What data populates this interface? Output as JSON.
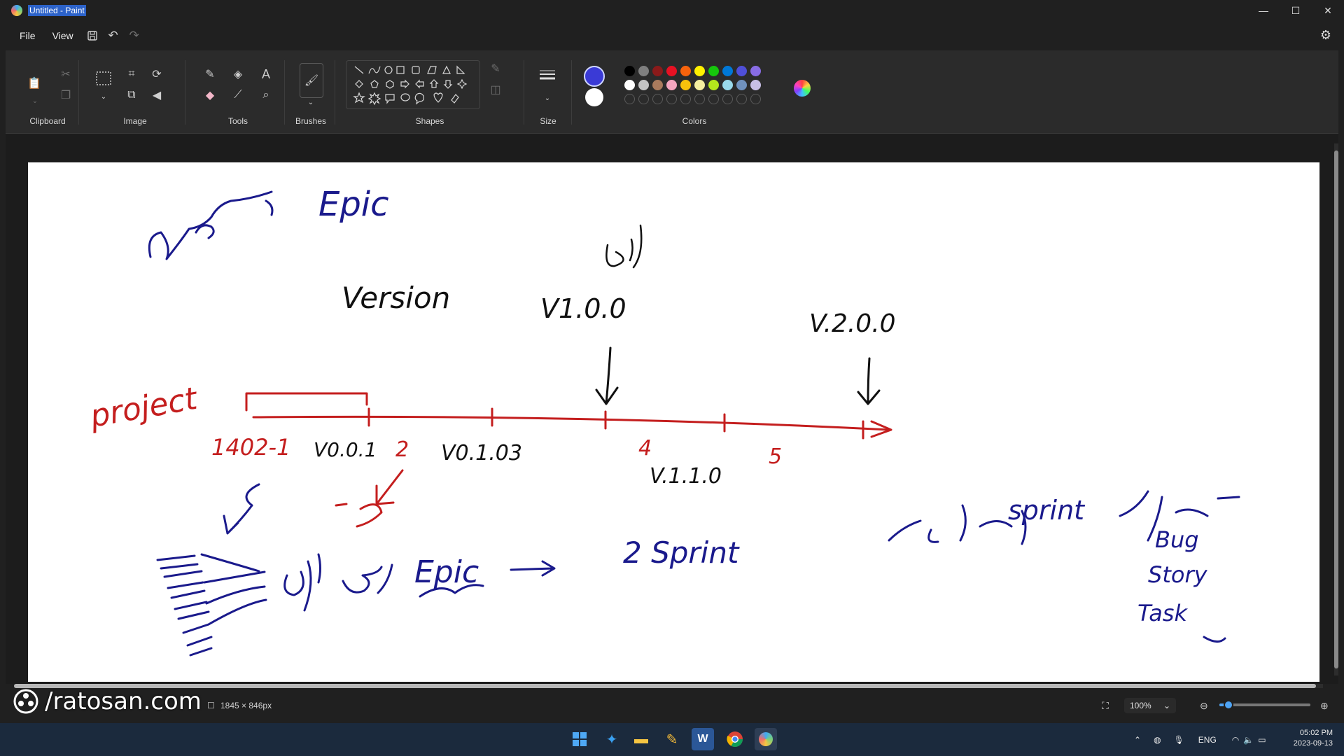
{
  "window": {
    "title": "Untitled - Paint",
    "minimize": "—",
    "maximize": "☐",
    "close": "✕"
  },
  "menu": {
    "file": "File",
    "view": "View"
  },
  "ribbon": {
    "clipboard": "Clipboard",
    "image": "Image",
    "tools": "Tools",
    "brushes": "Brushes",
    "shapes": "Shapes",
    "size": "Size",
    "colors": "Colors"
  },
  "colors": {
    "primary": "#3a3ad6",
    "secondary": "#ffffff",
    "row1": [
      "#000000",
      "#7f7f7f",
      "#8b1a1a",
      "#e81123",
      "#f7630c",
      "#fff100",
      "#16c60c",
      "#0078d7",
      "#4f4fd8",
      "#886ce4"
    ],
    "row2": [
      "#ffffff",
      "#c3c3c3",
      "#a97a5d",
      "#f4a6c0",
      "#f7c10c",
      "#f5efa0",
      "#b5e61d",
      "#99d9ea",
      "#7092be",
      "#c8bfe7"
    ]
  },
  "canvas_text": {
    "epic_top": "Epic",
    "version": "Version",
    "v100": "V1.0.0",
    "v200": "V.2.0.0",
    "project": "project",
    "d1": "1402-1",
    "v001": "V0.0.1",
    "n2": "2",
    "v003": "V0.1.03",
    "n4": "4",
    "n5": "5",
    "v110": "V.1.1.0",
    "epic_bottom": "Epic",
    "sprint": "2 Sprint",
    "sprint_note": "sprint",
    "bug": "Bug",
    "story": "Story",
    "task": "Task"
  },
  "status": {
    "size": "1845 × 846px",
    "zoom": "100%"
  },
  "watermark": "/ratosan.com",
  "tray": {
    "lang": "ENG",
    "time": "05:02 PM",
    "date": "2023-09-13"
  },
  "zoom_level": 0.1
}
